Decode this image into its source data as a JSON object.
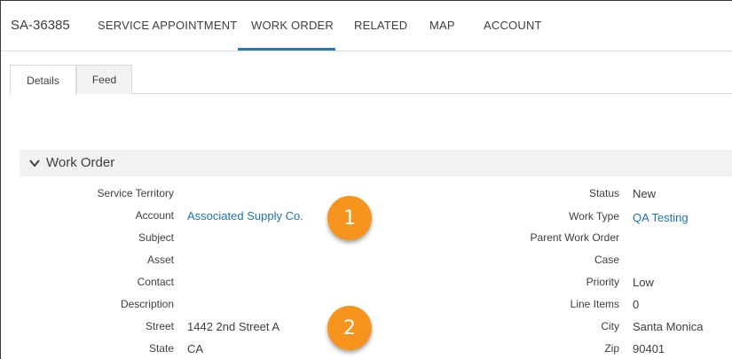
{
  "header": {
    "record_id": "SA-36385",
    "tabs": [
      {
        "label": "SERVICE APPOINTMENT"
      },
      {
        "label": "WORK ORDER"
      },
      {
        "label": "RELATED"
      },
      {
        "label": "MAP"
      },
      {
        "label": "ACCOUNT"
      }
    ],
    "active_tab": "WORK ORDER"
  },
  "subtabs": [
    {
      "label": "Details"
    },
    {
      "label": "Feed"
    }
  ],
  "section": {
    "title": "Work Order",
    "icon": "chevron-down-icon"
  },
  "fields_left": [
    {
      "label": "Service Territory",
      "value": ""
    },
    {
      "label": "Account",
      "value": "Associated Supply Co."
    },
    {
      "label": "Subject",
      "value": ""
    },
    {
      "label": "Asset",
      "value": ""
    },
    {
      "label": "Contact",
      "value": ""
    },
    {
      "label": "Description",
      "value": ""
    },
    {
      "label": "Street",
      "value": "1442 2nd Street A"
    },
    {
      "label": "State",
      "value": "CA"
    }
  ],
  "fields_right": [
    {
      "label": "Status",
      "value": "New"
    },
    {
      "label": "Work Type",
      "value": "QA Testing"
    },
    {
      "label": "Parent Work Order",
      "value": ""
    },
    {
      "label": "Case",
      "value": ""
    },
    {
      "label": "Priority",
      "value": "Low"
    },
    {
      "label": "Line Items",
      "value": "0"
    },
    {
      "label": "City",
      "value": "Santa Monica"
    },
    {
      "label": "Zip",
      "value": "90401"
    }
  ],
  "callouts": [
    {
      "number": "1"
    },
    {
      "number": "2"
    }
  ],
  "colors": {
    "link": "#1b74b4",
    "active_underline": "#2a7ab0",
    "callout": "#f7941d"
  }
}
